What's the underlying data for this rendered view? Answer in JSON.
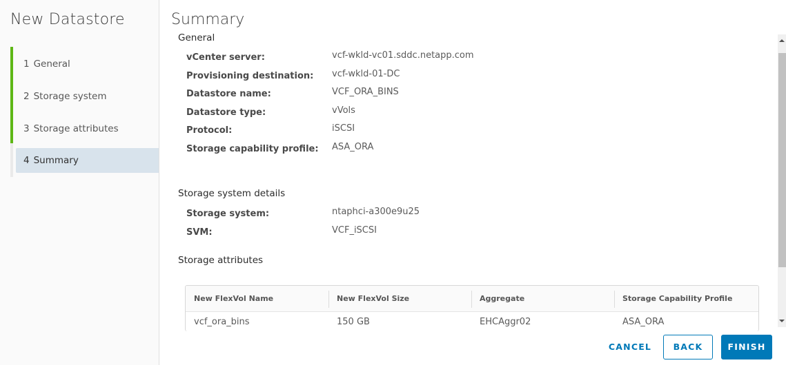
{
  "wizard": {
    "title": "New Datastore",
    "steps": [
      {
        "num": "1",
        "label": "General",
        "state": "completed"
      },
      {
        "num": "2",
        "label": "Storage system",
        "state": "completed"
      },
      {
        "num": "3",
        "label": "Storage attributes",
        "state": "completed"
      },
      {
        "num": "4",
        "label": "Summary",
        "state": "active"
      }
    ]
  },
  "colors": {
    "accent": "#0079b8",
    "step_complete": "#5eb715",
    "active_step_bg": "#d8e3ec"
  },
  "summary": {
    "title": "Summary",
    "general": {
      "heading": "General",
      "rows": [
        {
          "label": "vCenter server:",
          "value": "vcf-wkld-vc01.sddc.netapp.com"
        },
        {
          "label": "Provisioning destination:",
          "value": "vcf-wkld-01-DC"
        },
        {
          "label": "Datastore name:",
          "value": "VCF_ORA_BINS"
        },
        {
          "label": "Datastore type:",
          "value": "vVols"
        },
        {
          "label": "Protocol:",
          "value": "iSCSI"
        },
        {
          "label": "Storage capability profile:",
          "value": "ASA_ORA"
        }
      ]
    },
    "storage_system_details": {
      "heading": "Storage system details",
      "rows": [
        {
          "label": "Storage system:",
          "value": "ntaphci-a300e9u25"
        },
        {
          "label": "SVM:",
          "value": "VCF_iSCSI"
        }
      ]
    },
    "storage_attributes": {
      "heading": "Storage attributes",
      "columns": [
        "New FlexVol Name",
        "New FlexVol Size",
        "Aggregate",
        "Storage Capability Profile"
      ],
      "rows": [
        [
          "vcf_ora_bins",
          "150 GB",
          "EHCAggr02",
          "ASA_ORA"
        ]
      ]
    }
  },
  "footer": {
    "cancel_label": "CANCEL",
    "back_label": "BACK",
    "finish_label": "FINISH"
  }
}
